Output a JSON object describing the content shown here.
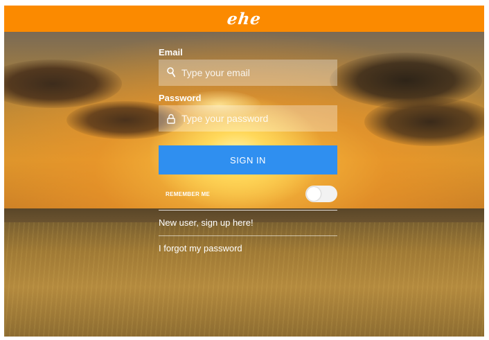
{
  "header": {
    "logo_text": "ehe",
    "color": "#fb8a00"
  },
  "form": {
    "email_label": "Email",
    "email_placeholder": "Type your email",
    "email_icon": "user-icon",
    "password_label": "Password",
    "password_placeholder": "Type your password",
    "password_icon": "lock-icon",
    "signin_label": "SIGN IN",
    "signin_color": "#2f8ff0",
    "remember_label": "REMEMBER ME",
    "signup_link": "New user, sign up here!",
    "forgot_link": "I forgot my password"
  }
}
